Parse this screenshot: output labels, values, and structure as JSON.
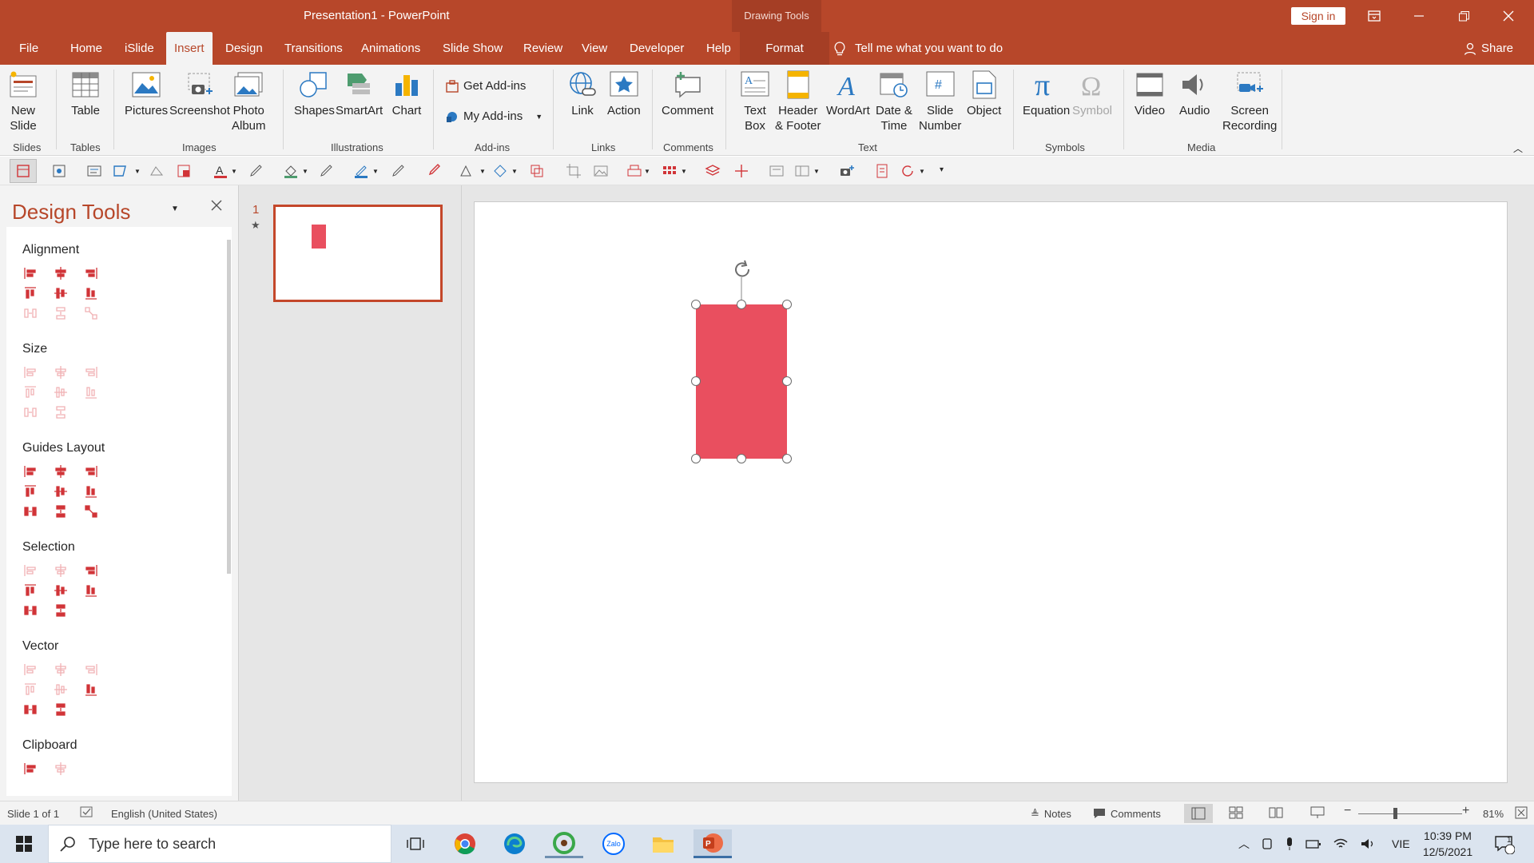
{
  "window": {
    "title": "Presentation1  -  PowerPoint",
    "context_tab_group": "Drawing Tools",
    "sign_in": "Sign in"
  },
  "tabs": [
    "File",
    "Home",
    "iSlide",
    "Insert",
    "Design",
    "Transitions",
    "Animations",
    "Slide Show",
    "Review",
    "View",
    "Developer",
    "Help",
    "Format"
  ],
  "active_tab": "Insert",
  "tell_me": "Tell me what you want to do",
  "share": "Share",
  "ribbon": {
    "new_slide": [
      "New",
      "Slide"
    ],
    "table": "Table",
    "pictures": "Pictures",
    "screenshot": "Screenshot",
    "photo_album": [
      "Photo",
      "Album"
    ],
    "shapes": "Shapes",
    "smartart": "SmartArt",
    "chart": "Chart",
    "get_addins": "Get Add-ins",
    "my_addins": "My Add-ins",
    "link": "Link",
    "action": "Action",
    "comment": "Comment",
    "text_box": [
      "Text",
      "Box"
    ],
    "header_footer": [
      "Header",
      "& Footer"
    ],
    "wordart": "WordArt",
    "date_time": [
      "Date &",
      "Time"
    ],
    "slide_number": [
      "Slide",
      "Number"
    ],
    "object": "Object",
    "equation": "Equation",
    "symbol": "Symbol",
    "video": "Video",
    "audio": "Audio",
    "screen_recording": [
      "Screen",
      "Recording"
    ],
    "groups": {
      "slides": "Slides",
      "tables": "Tables",
      "images": "Images",
      "illustrations": "Illustrations",
      "addins": "Add-ins",
      "links": "Links",
      "comments": "Comments",
      "text": "Text",
      "symbols": "Symbols",
      "media": "Media"
    }
  },
  "design_tools": {
    "title": "Design Tools",
    "sections": [
      "Alignment",
      "Size",
      "Guides Layout",
      "Selection",
      "Vector",
      "Clipboard"
    ]
  },
  "thumbnail": {
    "number": "1",
    "star": "★"
  },
  "status": {
    "slide_of": "Slide 1 of 1",
    "language": "English (United States)",
    "notes": "Notes",
    "comments": "Comments",
    "zoom": "81%"
  },
  "taskbar": {
    "search_placeholder": "Type here to search",
    "zalo": "Zalo",
    "lang": "VIE",
    "time": "10:39 PM",
    "date": "12/5/2021",
    "notif_count": "1"
  },
  "colors": {
    "accent": "#b7472a",
    "shape_fill": "#e94f5f",
    "tool_icon": "#d13438"
  }
}
